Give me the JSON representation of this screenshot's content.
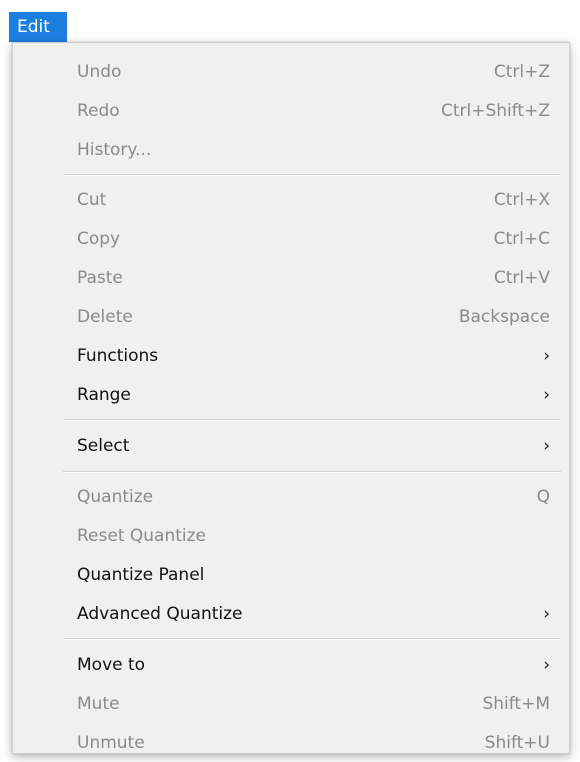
{
  "menubar": {
    "edit_label": "Edit"
  },
  "menu": {
    "items": [
      {
        "label": "Undo",
        "shortcut": "Ctrl+Z"
      },
      {
        "label": "Redo",
        "shortcut": "Ctrl+Shift+Z"
      },
      {
        "label": "History..."
      },
      {
        "label": "Cut",
        "shortcut": "Ctrl+X"
      },
      {
        "label": "Copy",
        "shortcut": "Ctrl+C"
      },
      {
        "label": "Paste",
        "shortcut": "Ctrl+V"
      },
      {
        "label": "Delete",
        "shortcut": "Backspace"
      },
      {
        "label": "Functions",
        "submenu": true
      },
      {
        "label": "Range",
        "submenu": true
      },
      {
        "label": "Select",
        "submenu": true
      },
      {
        "label": "Quantize",
        "shortcut": "Q"
      },
      {
        "label": "Reset Quantize"
      },
      {
        "label": "Quantize Panel"
      },
      {
        "label": "Advanced Quantize",
        "submenu": true
      },
      {
        "label": "Move to",
        "submenu": true
      },
      {
        "label": "Mute",
        "shortcut": "Shift+M"
      },
      {
        "label": "Unmute",
        "shortcut": "Shift+U"
      }
    ]
  },
  "colors": {
    "menubar_active_bg": "#1c7fe0",
    "menu_bg": "#f0f0f0",
    "disabled_text": "#8a8a8a",
    "enabled_text": "#111111"
  }
}
